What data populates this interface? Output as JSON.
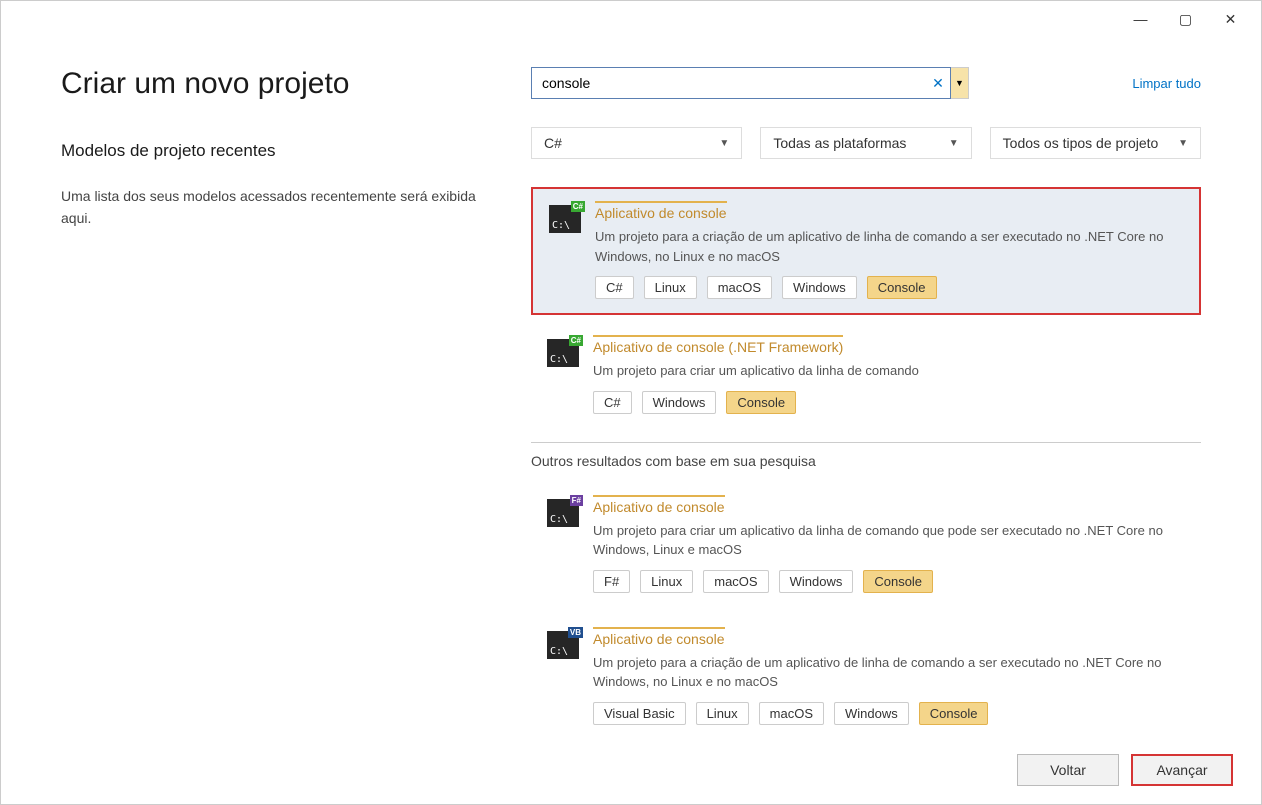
{
  "titlebar": {
    "minimize": "—",
    "maximize": "▢",
    "close": "✕"
  },
  "page": {
    "title": "Criar um novo projeto",
    "recent_heading": "Modelos de projeto recentes",
    "recent_hint": "Uma lista dos seus modelos acessados recentemente será exibida aqui."
  },
  "search": {
    "value": "console",
    "clear_all": "Limpar tudo"
  },
  "filters": {
    "language": "C#",
    "platform": "Todas as plataformas",
    "type": "Todos os tipos de projeto"
  },
  "templates": [
    {
      "icon_tag": "C#",
      "title": "Aplicativo de console",
      "desc": "Um projeto para a criação de um aplicativo de linha de comando a ser executado no .NET Core no Windows, no Linux e no macOS",
      "tags": [
        "C#",
        "Linux",
        "macOS",
        "Windows",
        "Console"
      ],
      "hl_tag": "Console",
      "selected": true
    },
    {
      "icon_tag": "C#",
      "title": "Aplicativo de console (.NET Framework)",
      "desc": "Um projeto para criar um aplicativo da linha de comando",
      "tags": [
        "C#",
        "Windows",
        "Console"
      ],
      "hl_tag": "Console",
      "selected": false
    }
  ],
  "other_label": "Outros resultados com base em sua pesquisa",
  "other_templates": [
    {
      "icon_tag": "F#",
      "title": "Aplicativo de console",
      "desc": "Um projeto para criar um aplicativo da linha de comando que pode ser executado no .NET Core no Windows, Linux e macOS",
      "tags": [
        "F#",
        "Linux",
        "macOS",
        "Windows",
        "Console"
      ],
      "hl_tag": "Console"
    },
    {
      "icon_tag": "VB",
      "title": "Aplicativo de console",
      "desc": "Um projeto para a criação de um aplicativo de linha de comando a ser executado no .NET Core no Windows, no Linux e no macOS",
      "tags": [
        "Visual Basic",
        "Linux",
        "macOS",
        "Windows",
        "Console"
      ],
      "hl_tag": "Console"
    }
  ],
  "footer": {
    "back": "Voltar",
    "next": "Avançar"
  }
}
